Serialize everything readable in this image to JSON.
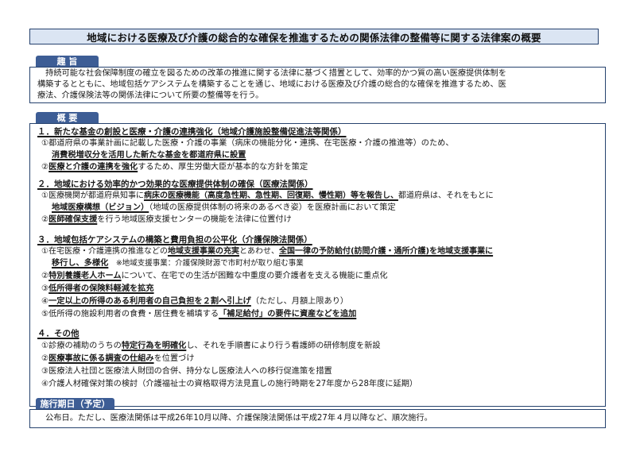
{
  "title": "地域における医療及び介護の総合的な確保を推進するための関係法律の整備等に関する法律案の概要",
  "shushi": {
    "tab": "趣 旨",
    "lines": [
      "　持続可能な社会保障制度の確立を図るための改革の推進に関する法律に基づく措置として、効率的かつ質の高い医療提供体制を",
      "構築するとともに、地域包括ケアシステムを構築することを通じ、地域における医療及び介護の総合的な確保を推進するため、医",
      "療法、介護保険法等の関係法律について所要の整備等を行う。"
    ]
  },
  "gaiyo": {
    "tab": "概 要",
    "s1": {
      "heading": "１．新たな基金の創設と医療・介護の連携強化（地域介護施設整備促進法等関係）",
      "l1": "①都道府県の事業計画に記載した医療・介護の事業（病床の機能分化・連携、在宅医療・介護の推進等）のため、",
      "l2": "消費税増収分を活用した新たな基金を都道府県に設置",
      "l3a": "②",
      "l3b": "医療と介護の連携を強化",
      "l3c": "するため、厚生労働大臣が基本的な方針を策定"
    },
    "s2": {
      "heading": "２．地域における効率的かつ効果的な医療提供体制の確保（医療法関係）",
      "l1a": "①医療機関が都道府県知事に",
      "l1b": "病床の医療機能（高度急性期、急性期、回復期、慢性期）等を報告し、",
      "l1c": "都道府県は、それをもとに",
      "l2a": "地域医療構想（ビジョン）",
      "l2b": "（地域の医療提供体制の将来のあるべき姿）を医療計画において策定",
      "l3a": "②",
      "l3b": "医師確保支援",
      "l3c": "を行う地域医療支援センターの機能を法律に位置付け"
    },
    "s3": {
      "heading": "３．地域包括ケアシステムの構築と費用負担の公平化（介護保険法関係）",
      "l1a": "①在宅医療・介護連携の推進などの",
      "l1b": "地域支援事業の充実",
      "l1c": "とあわせ、",
      "l1d": "全国一律の予防給付(訪問介護・通所介護)を地域支援事業に",
      "l2a": "移行し、多様化",
      "l2b": "　※地域支援事業：介護保険財源で市町村が取り組む事業",
      "l3a": "②",
      "l3b": "特別養護老人ホーム",
      "l3c": "について、在宅での生活が困難な中重度の要介護者を支える機能に重点化",
      "l4a": "③",
      "l4b": "低所得者の保険料軽減を拡充",
      "l5a": "④",
      "l5b": "一定以上の所得のある利用者の自己負担を２割へ引上げ",
      "l5c": "（ただし、月額上限あり）",
      "l6a": "⑤低所得の施設利用者の食費・居住費を補填する",
      "l6b": "「補足給付」の要件に資産などを追加"
    },
    "s4": {
      "heading": "４．その他",
      "l1a": "①診療の補助のうちの",
      "l1b": "特定行為を明確化",
      "l1c": "し、それを手順書により行う看護師の研修制度を新設",
      "l2a": "②",
      "l2b": "医療事故に係る調査の仕組み",
      "l2c": "を位置づけ",
      "l3": "③医療法人社団と医療法人財団の合併、持分なし医療法人への移行促進策を措置",
      "l4": "④介護人材確保対策の検討（介護福祉士の資格取得方法見直しの施行時期を27年度から28年度に延期）"
    }
  },
  "shiko": {
    "tab": "施行期日（予定）",
    "text": "　公布日。ただし、医療法関係は平成26年10月以降、介護保険法関係は平成27年４月以降など、順次施行。"
  }
}
